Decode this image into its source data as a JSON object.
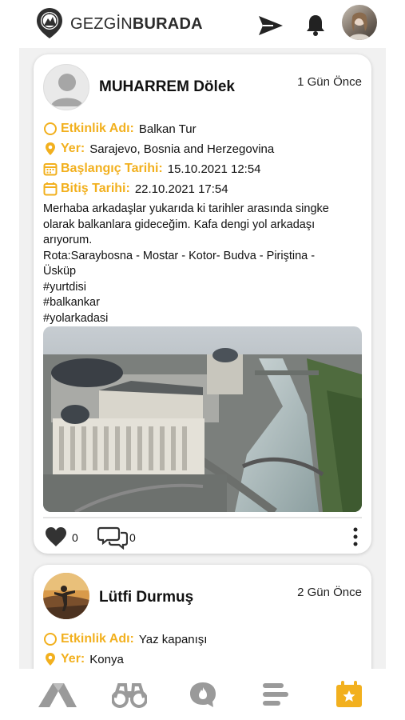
{
  "header": {
    "brand_light": "GEZGİN",
    "brand_bold": "BURADA",
    "icons": [
      "compass-logo-icon",
      "send-icon",
      "bell-icon",
      "avatar"
    ]
  },
  "posts": [
    {
      "user": "MUHARREM Dölek",
      "time": "1 Gün Önce",
      "event_label": "Etkinlik Adı:",
      "event_value": "Balkan Tur",
      "place_label": "Yer:",
      "place_value": "Sarajevo, Bosnia and Herzegovina",
      "start_label": "Başlangıç Tarihi:",
      "start_value": "15.10.2021 12:54",
      "end_label": "Bitiş Tarihi:",
      "end_value": "22.10.2021 17:54",
      "description": [
        "Merhaba arkadaşlar yukarıda ki tarihler arasında singke",
        "olarak balkanlara gideceğim. Kafa dengi yol arkadaşı",
        "arıyorum.",
        "Rota:Saraybosna - Mostar - Kotor- Budva - Piriştina -",
        "Üsküp",
        "#yurtdisi",
        "#balkankar",
        "#yolarkadasi"
      ],
      "likes": "0",
      "comments": "0"
    },
    {
      "user": "Lütfi Durmuş",
      "time": "2 Gün Önce",
      "event_label": "Etkinlik Adı:",
      "event_value": "Yaz kapanışı",
      "place_label": "Yer:",
      "place_value": "Konya"
    }
  ],
  "colors": {
    "accent": "#f2b01e",
    "nav_gray": "#9a9a9a",
    "feed_bg": "#f1f1f1"
  },
  "bottom_nav": [
    "mountain-icon",
    "binoculars-icon",
    "chat-fire-icon",
    "list-icon",
    "calendar-star-icon"
  ]
}
